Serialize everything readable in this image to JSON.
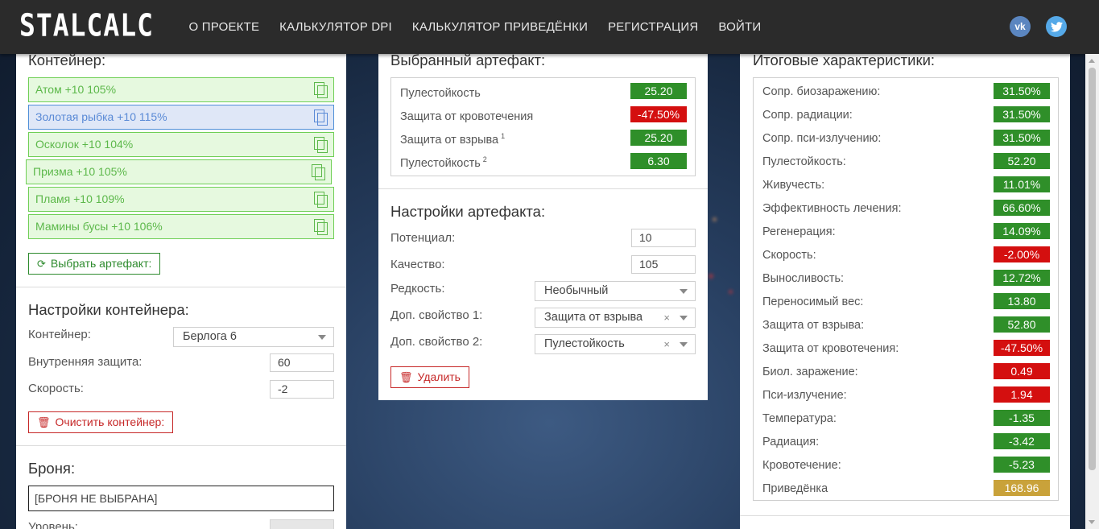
{
  "header": {
    "logo": "STALCALC",
    "nav": [
      "О ПРОЕКТЕ",
      "КАЛЬКУЛЯТОР DPI",
      "КАЛЬКУЛЯТОР ПРИВЕДЁНКИ",
      "РЕГИСТРАЦИЯ",
      "ВОЙТИ"
    ],
    "social": [
      {
        "icon": "vk-icon",
        "text": "vk"
      },
      {
        "icon": "twitter-icon"
      }
    ]
  },
  "container": {
    "title": "Контейнер:",
    "slots": [
      {
        "label": "Атом +10 105%",
        "selected": false
      },
      {
        "label": "Золотая рыбка +10 115%",
        "selected": true
      },
      {
        "label": "Осколок +10 104%",
        "selected": false
      },
      {
        "label": "Призма +10 105%",
        "selected": false
      },
      {
        "label": "Пламя +10 109%",
        "selected": false
      },
      {
        "label": "Мамины бусы +10 106%",
        "selected": false
      }
    ],
    "select_button": "Выбрать артефакт:"
  },
  "container_settings": {
    "title": "Настройки контейнера:",
    "container_label": "Контейнер:",
    "container_value": "Берлога 6",
    "inner_protection_label": "Внутренняя защита:",
    "inner_protection_value": "60",
    "speed_label": "Скорость:",
    "speed_value": "-2",
    "clear_button": "Очистить контейнер:"
  },
  "armor": {
    "title": "Броня:",
    "value": "[БРОНЯ НЕ ВЫБРАНА]",
    "level_label": "Уровень:"
  },
  "selected_artifact": {
    "title": "Выбранный артефакт:",
    "stats": [
      {
        "name": "Пулестойкость",
        "sup": "",
        "value": "25.20",
        "color": "g"
      },
      {
        "name": "Защита от кровотечения",
        "sup": "",
        "value": "-47.50%",
        "color": "r"
      },
      {
        "name": "Защита от взрыва",
        "sup": "1",
        "value": "25.20",
        "color": "g"
      },
      {
        "name": "Пулестойкость",
        "sup": "2",
        "value": "6.30",
        "color": "g"
      }
    ]
  },
  "artifact_settings": {
    "title": "Настройки артефакта:",
    "potential_label": "Потенциал:",
    "potential_value": "10",
    "quality_label": "Качество:",
    "quality_value": "105",
    "rarity_label": "Редкость:",
    "rarity_value": "Необычный",
    "extra1_label": "Доп. свойство 1:",
    "extra1_value": "Защита от взрыва",
    "extra2_label": "Доп. свойство 2:",
    "extra2_value": "Пулестойкость",
    "delete_button": "Удалить"
  },
  "totals": {
    "title": "Итоговые характеристики:",
    "stats": [
      {
        "name": "Сопр. биозаражению:",
        "value": "31.50%",
        "color": "g"
      },
      {
        "name": "Сопр. радиации:",
        "value": "31.50%",
        "color": "g"
      },
      {
        "name": "Сопр. пси-излучению:",
        "value": "31.50%",
        "color": "g"
      },
      {
        "name": "Пулестойкость:",
        "value": "52.20",
        "color": "g"
      },
      {
        "name": "Живучесть:",
        "value": "11.01%",
        "color": "g"
      },
      {
        "name": "Эффективность лечения:",
        "value": "66.60%",
        "color": "g"
      },
      {
        "name": "Регенерация:",
        "value": "14.09%",
        "color": "g"
      },
      {
        "name": "Скорость:",
        "value": "-2.00%",
        "color": "r"
      },
      {
        "name": "Выносливость:",
        "value": "12.72%",
        "color": "g"
      },
      {
        "name": "Переносимый вес:",
        "value": "13.80",
        "color": "g"
      },
      {
        "name": "Защита от взрыва:",
        "value": "52.80",
        "color": "g"
      },
      {
        "name": "Защита от кровотечения:",
        "value": "-47.50%",
        "color": "r"
      },
      {
        "name": "Биол. заражение:",
        "value": "0.49",
        "color": "r"
      },
      {
        "name": "Пси-излучение:",
        "value": "1.94",
        "color": "r"
      },
      {
        "name": "Температура:",
        "value": "-1.35",
        "color": "g"
      },
      {
        "name": "Радиация:",
        "value": "-3.42",
        "color": "g"
      },
      {
        "name": "Кровотечение:",
        "value": "-5.23",
        "color": "g"
      },
      {
        "name": "Приведёнка",
        "value": "168.96",
        "color": "y"
      }
    ]
  },
  "colors": {
    "green": "#2f8f29",
    "red": "#d40f0f",
    "gold": "#c9a23a"
  }
}
